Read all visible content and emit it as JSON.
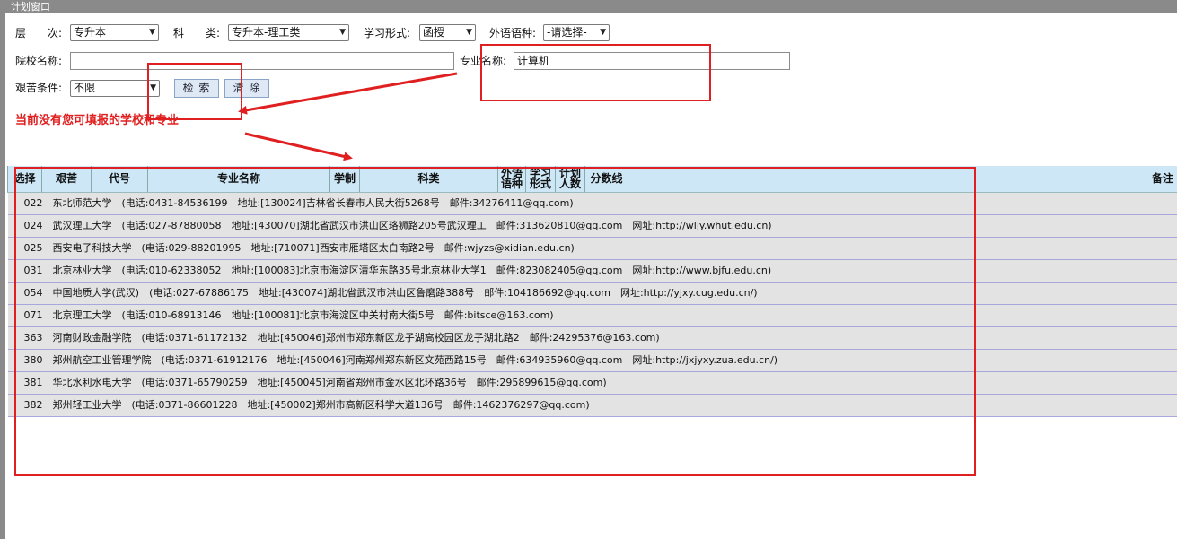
{
  "window": {
    "title": "计划窗口"
  },
  "filters": {
    "level_label": "层　　次:",
    "level_value": "专升本",
    "category_label": "科　　类:",
    "category_value": "专升本-理工类",
    "study_form_label": "学习形式:",
    "study_form_value": "函授",
    "foreign_lang_label": "外语语种:",
    "foreign_lang_value": "-请选择-",
    "school_name_label": "院校名称:",
    "school_name_value": "",
    "major_name_label": "专业名称:",
    "major_name_value": "计算机",
    "hardship_label": "艰苦条件:",
    "hardship_value": "不限",
    "search_label": "检 索",
    "clear_label": "清 除"
  },
  "hint": "当前没有您可填报的学校和专业",
  "table": {
    "headers": [
      "选择",
      "艰苦",
      "代号",
      "专业名称",
      "学制",
      "科类",
      "外语\n语种",
      "学习\n形式",
      "计划\n人数",
      "分数线",
      "备注"
    ],
    "rows": [
      "022　东北师范大学　(电话:0431-84536199　地址:[130024]吉林省长春市人民大街5268号　邮件:34276411@qq.com)",
      "024　武汉理工大学　(电话:027-87880058　地址:[430070]湖北省武汉市洪山区珞狮路205号武汉理工　邮件:313620810@qq.com　网址:http://wljy.whut.edu.cn)",
      "025　西安电子科技大学　(电话:029-88201995　地址:[710071]西安市雁塔区太白南路2号　邮件:wjyzs@xidian.edu.cn)",
      "031　北京林业大学　(电话:010-62338052　地址:[100083]北京市海淀区清华东路35号北京林业大学1　邮件:823082405@qq.com　网址:http://www.bjfu.edu.cn)",
      "054　中国地质大学(武汉)　(电话:027-67886175　地址:[430074]湖北省武汉市洪山区鲁磨路388号　邮件:104186692@qq.com　网址:http://yjxy.cug.edu.cn/)",
      "071　北京理工大学　(电话:010-68913146　地址:[100081]北京市海淀区中关村南大街5号　邮件:bitsce@163.com)",
      "363　河南财政金融学院　(电话:0371-61172132　地址:[450046]郑州市郑东新区龙子湖高校园区龙子湖北路2　邮件:24295376@163.com)",
      "380　郑州航空工业管理学院　(电话:0371-61912176　地址:[450046]河南郑州郑东新区文苑西路15号　邮件:634935960@qq.com　网址:http://jxjyxy.zua.edu.cn/)",
      "381　华北水利水电大学　(电话:0371-65790259　地址:[450045]河南省郑州市金水区北环路36号　邮件:295899615@qq.com)",
      "382　郑州轻工业大学　(电话:0371-86601228　地址:[450002]郑州市高新区科学大道136号　邮件:1462376297@qq.com)"
    ]
  },
  "colors": {
    "annotation": "#e02020",
    "header_bg": "#cde7f7",
    "row_bg": "#e3e3e3",
    "titlebar": "#8a8a8a"
  },
  "icons": {
    "dropdown": "chevron-down-icon"
  }
}
